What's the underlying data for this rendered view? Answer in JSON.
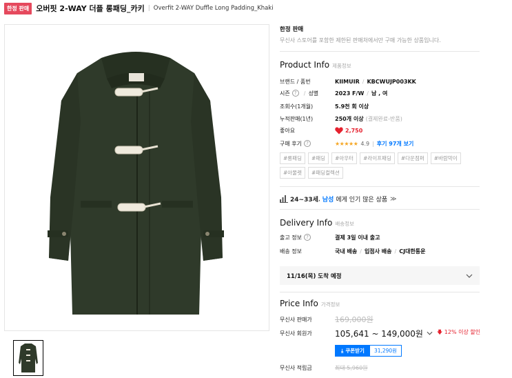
{
  "header": {
    "badge": "한정 판매",
    "title_kr": "오버핏 2-WAY 더플 롱패딩_카키",
    "separator": "|",
    "title_en": "Overfit 2-WAY Duffle Long Padding_Khaki"
  },
  "limited": {
    "title": "한정 판매",
    "desc": "무신사 스토어를 포함한 제한된 판매처에서만 구매 가능한 상품입니다."
  },
  "product_info": {
    "title": "Product Info",
    "sub": "제품정보",
    "brand_label": "브랜드 / 품번",
    "brand": "KIIMUIR",
    "code": "KBCWUJP003KK",
    "season_label_a": "시즌",
    "season_label_b": "성별",
    "season": "2023 F/W",
    "gender": "남 , 여",
    "views_label": "조회수(1개월)",
    "views": "5.9천 회 이상",
    "sales_label": "누적판매(1년)",
    "sales": "250개 이상",
    "sales_note": "(결제완료-반품)",
    "likes_label": "좋아요",
    "likes": "2,750",
    "review_label": "구매 후기",
    "stars": "★★★★★",
    "rating": "4.9",
    "review_link": "후기 97개 보기"
  },
  "tags": [
    "#롱패딩",
    "#패딩",
    "#아우터",
    "#라이프패딩",
    "#다운점퍼",
    "#바람막이",
    "#아물렛",
    "#패딩컬렉션"
  ],
  "popular": {
    "age": "24~33세",
    "comma": ",",
    "gender": "남성",
    "text": "에게 인기 많은 상품"
  },
  "delivery_info": {
    "title": "Delivery Info",
    "sub": "배송정보",
    "release_label": "출고 정보",
    "release": "결제 3일 이내 출고",
    "ship_label": "배송 정보",
    "ship_a": "국내 배송",
    "ship_b": "입점사 배송",
    "ship_c": "CJ대한통운",
    "arrival": "11/16(목) 도착 예정"
  },
  "price_info": {
    "title": "Price Info",
    "sub": "가격정보",
    "sale_label": "무신사 판매가",
    "sale_price": "169,000원",
    "member_label": "무신사 회원가",
    "member_price": "105,641 ~ 149,000원",
    "discount": "12% 이상 할인",
    "coupon_btn": "쿠폰받기",
    "coupon_amount": "31,290원",
    "points_label": "무신사 적립금",
    "points": "최대 5,960원"
  },
  "colors": {
    "accent_red": "#e5495d",
    "link_blue": "#0078ff",
    "coat_khaki": "#2f3a2a"
  }
}
